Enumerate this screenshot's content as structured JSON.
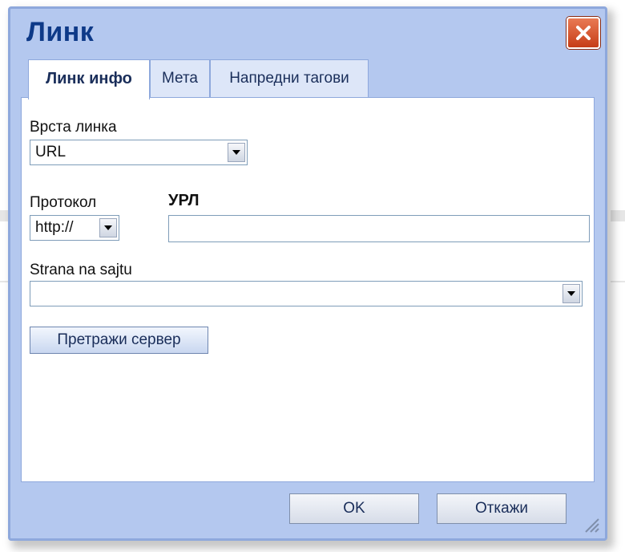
{
  "dialog": {
    "title": "Линк",
    "close_icon": "close-icon",
    "accent_color": "#0e3a88",
    "close_color": "#d9542b"
  },
  "tabs": [
    {
      "label": "Линк инфо",
      "active": true
    },
    {
      "label": "Мета",
      "active": false
    },
    {
      "label": "Напредни тагови",
      "active": false
    }
  ],
  "link_type": {
    "label": "Врста линка",
    "value": "URL"
  },
  "protocol": {
    "label": "Протокол",
    "value": "http://"
  },
  "url": {
    "label": "УРЛ",
    "value": ""
  },
  "site_page": {
    "label": "Strana na sajtu",
    "value": ""
  },
  "browse_button": {
    "label": "Претражи сервер"
  },
  "footer": {
    "ok_label": "OK",
    "cancel_label": "Откажи"
  }
}
